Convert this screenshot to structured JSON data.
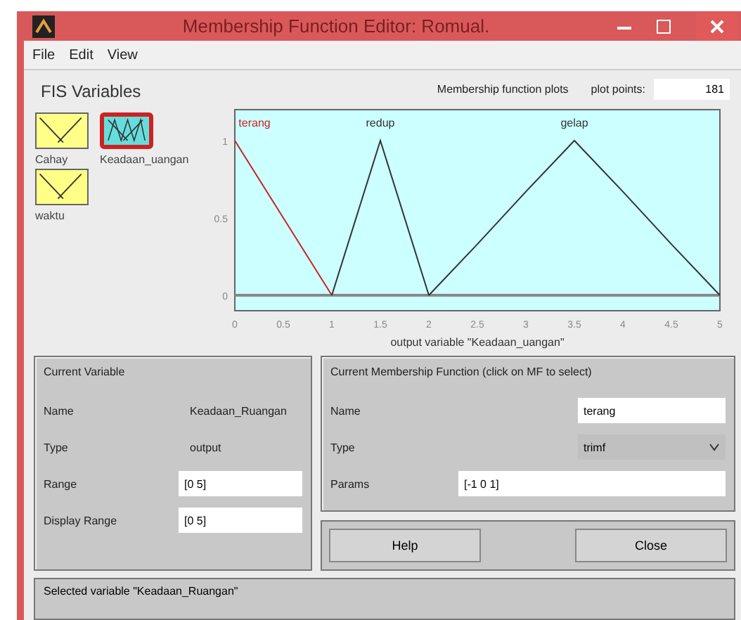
{
  "window": {
    "title": "Membership Function Editor: Romual."
  },
  "menu": [
    "File",
    "Edit",
    "View"
  ],
  "fis_variables": {
    "title": "FIS Variables",
    "items": [
      {
        "label": "Cahay",
        "kind": "input",
        "selected": false
      },
      {
        "label": "Keadaan_uangan",
        "kind": "output",
        "selected": true
      },
      {
        "label": "waktu",
        "kind": "input",
        "selected": false
      }
    ]
  },
  "plot": {
    "title": "Membership function plots",
    "plot_points_label": "plot points:",
    "plot_points": "181",
    "chart_data": {
      "type": "line",
      "xlabel": "output variable \"Keadaan_uangan\"",
      "x": [
        0,
        0.5,
        1,
        1.5,
        2,
        2.5,
        3,
        3.5,
        4,
        4.5,
        5
      ],
      "series": [
        {
          "name": "terang",
          "color": "#cc2222",
          "values": [
            1,
            0.5,
            0,
            null,
            null,
            null,
            null,
            null,
            null,
            null,
            null
          ]
        },
        {
          "name": "redup",
          "color": "#333333",
          "values": [
            null,
            null,
            0,
            1,
            0,
            null,
            null,
            null,
            null,
            null,
            null
          ]
        },
        {
          "name": "gelap",
          "color": "#333333",
          "values": [
            null,
            null,
            null,
            null,
            0,
            0.33,
            0.67,
            1,
            0.67,
            0.33,
            0
          ]
        }
      ],
      "xlim": [
        0,
        5
      ],
      "ylim": [
        -0.1,
        1.2
      ],
      "xticks": [
        0,
        0.5,
        1,
        1.5,
        2,
        2.5,
        3,
        3.5,
        4,
        4.5,
        5
      ],
      "yticks": [
        0,
        0.5,
        1
      ]
    }
  },
  "current_variable": {
    "title": "Current Variable",
    "name_label": "Name",
    "name": "Keadaan_Ruangan",
    "type_label": "Type",
    "type": "output",
    "range_label": "Range",
    "range": "[0 5]",
    "display_range_label": "Display Range",
    "display_range": "[0 5]"
  },
  "current_mf": {
    "title": "Current Membership Function (click on MF to select)",
    "name_label": "Name",
    "name": "terang",
    "type_label": "Type",
    "type": "trimf",
    "params_label": "Params",
    "params": "[-1 0 1]"
  },
  "buttons": [
    "Help",
    "Close"
  ],
  "status": "Selected variable \"Keadaan_Ruangan\""
}
